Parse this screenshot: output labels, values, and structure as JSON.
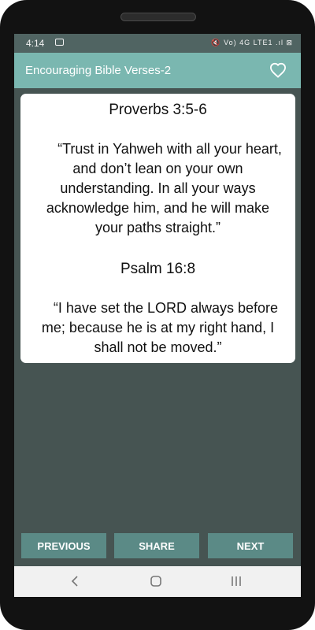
{
  "status_bar": {
    "time": "4:14",
    "mail_icon": "mail-icon",
    "indicators": "🔇 Vo) 4G LTE1 .ıl ⊠"
  },
  "app_bar": {
    "title": "Encouraging Bible Verses-2",
    "favorite_icon": "heart-outline-icon"
  },
  "card": {
    "verse1_ref": "Proverbs 3:5-6",
    "verse1_text": "“Trust in Yahweh with all your heart, and don’t lean on your own understanding. In all your ways acknowledge him, and he will make your paths straight.”",
    "verse2_ref": "Psalm 16:8",
    "verse2_text": "“I have set the LORD always before me; because he is at my right hand, I shall not be moved.”"
  },
  "buttons": {
    "previous": "PREVIOUS",
    "share": "SHARE",
    "next": "NEXT"
  },
  "nav_bar": {
    "back_icon": "back-chevron-icon",
    "home_icon": "home-icon",
    "recents_icon": "recents-icon"
  },
  "colors": {
    "app_bar": "#7ab7b0",
    "status_bar": "#506462",
    "background": "#465452",
    "button": "#5b8a86",
    "nav_bar": "#f1f1f1"
  }
}
